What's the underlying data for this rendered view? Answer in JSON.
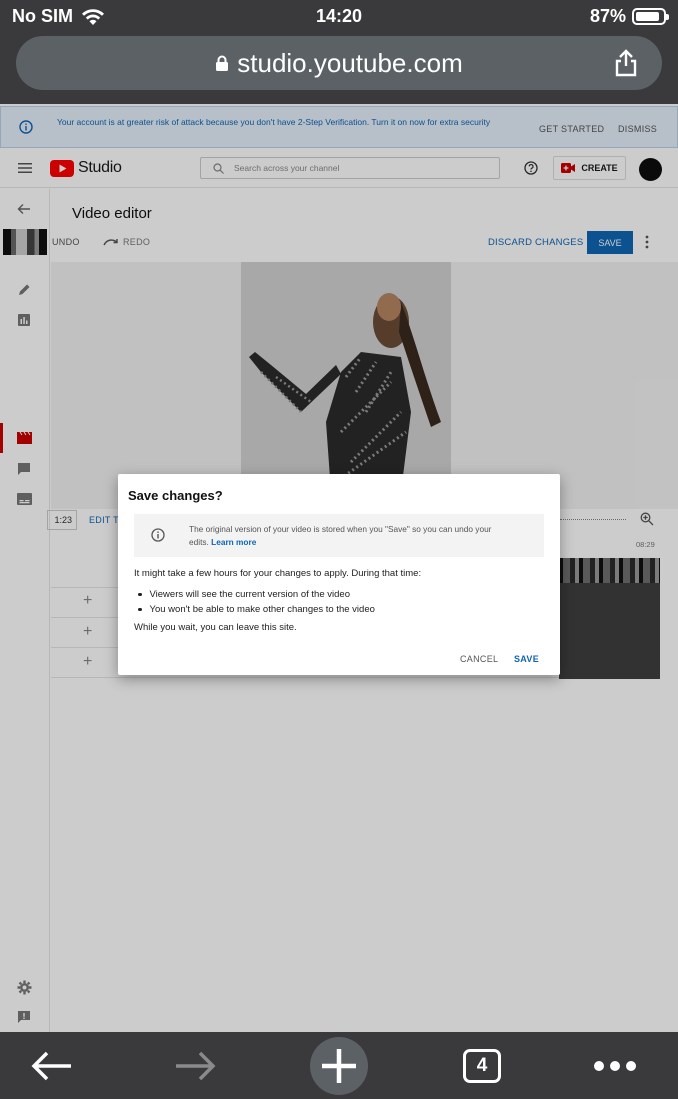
{
  "status": {
    "carrier": "No SIM",
    "time": "14:20",
    "battery": "87%",
    "battery_level": 0.87
  },
  "browser": {
    "url": "studio.youtube.com",
    "tab_count": "4"
  },
  "banner": {
    "message": "Your account is at greater risk of attack because you don't have 2-Step Verification. Turn it on now for extra security",
    "get_started": "GET STARTED",
    "dismiss": "DISMISS"
  },
  "appbar": {
    "logo_text": "Studio",
    "search_placeholder": "Search across your channel",
    "create_label": "CREATE"
  },
  "editor": {
    "title": "Video editor",
    "undo": "UNDO",
    "redo": "REDO",
    "discard": "DISCARD CHANGES",
    "save": "SAVE",
    "time_value": "1:23",
    "edit_trim": "EDIT T",
    "timestamp": "08:29"
  },
  "dialog": {
    "title": "Save changes?",
    "info_text": "The original version of your video is stored when you \"Save\" so you can undo your edits.",
    "learn_more": "Learn more",
    "body": "It might take a few hours for your changes to apply. During that time:",
    "bullets": [
      "Viewers will see the current version of the video",
      "You won't be able to make other changes to the video"
    ],
    "wait_text": "While you wait, you can leave this site.",
    "cancel": "CANCEL",
    "save": "SAVE"
  },
  "colors": {
    "accent": "#0f66b5",
    "youtube_red": "#ff0000",
    "active_red": "#cc0000"
  }
}
